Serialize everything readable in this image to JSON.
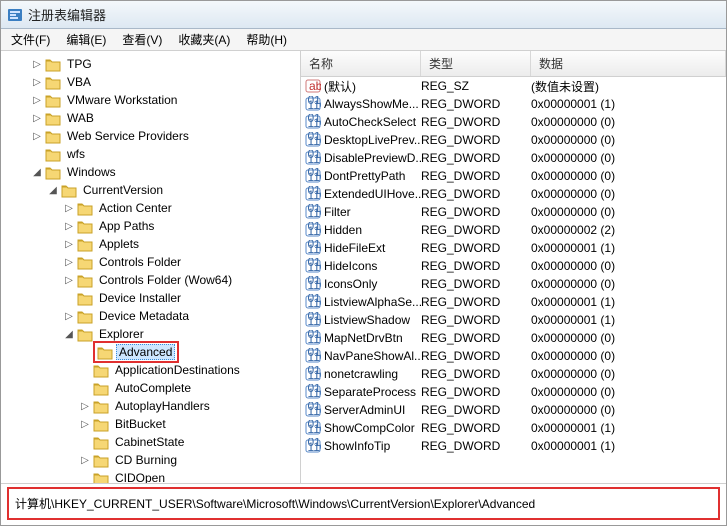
{
  "window": {
    "title": "注册表编辑器"
  },
  "menu": {
    "file": "文件(F)",
    "edit": "编辑(E)",
    "view": "查看(V)",
    "favorites": "收藏夹(A)",
    "help": "帮助(H)"
  },
  "tree": {
    "nodes": [
      {
        "label": "TPG",
        "caret": "closed"
      },
      {
        "label": "VBA",
        "caret": "closed"
      },
      {
        "label": "VMware Workstation",
        "caret": "closed"
      },
      {
        "label": "WAB",
        "caret": "closed"
      },
      {
        "label": "Web Service Providers",
        "caret": "closed"
      },
      {
        "label": "wfs",
        "caret": "none"
      },
      {
        "label": "Windows",
        "caret": "open",
        "children": [
          {
            "label": "CurrentVersion",
            "caret": "open",
            "children": [
              {
                "label": "Action Center",
                "caret": "closed"
              },
              {
                "label": "App Paths",
                "caret": "closed"
              },
              {
                "label": "Applets",
                "caret": "closed"
              },
              {
                "label": "Controls Folder",
                "caret": "closed"
              },
              {
                "label": "Controls Folder (Wow64)",
                "caret": "closed"
              },
              {
                "label": "Device Installer",
                "caret": "none"
              },
              {
                "label": "Device Metadata",
                "caret": "closed"
              },
              {
                "label": "Explorer",
                "caret": "open",
                "children": [
                  {
                    "label": "Advanced",
                    "caret": "none",
                    "selected": true,
                    "highlighted": true
                  },
                  {
                    "label": "ApplicationDestinations",
                    "caret": "none"
                  },
                  {
                    "label": "AutoComplete",
                    "caret": "none"
                  },
                  {
                    "label": "AutoplayHandlers",
                    "caret": "closed"
                  },
                  {
                    "label": "BitBucket",
                    "caret": "closed"
                  },
                  {
                    "label": "CabinetState",
                    "caret": "none"
                  },
                  {
                    "label": "CD Burning",
                    "caret": "closed"
                  },
                  {
                    "label": "CIDOpen",
                    "caret": "none"
                  }
                ]
              }
            ]
          }
        ]
      }
    ]
  },
  "list": {
    "cols": {
      "name": "名称",
      "type": "类型",
      "data": "数据"
    },
    "rows": [
      {
        "name": "(默认)",
        "type": "REG_SZ",
        "data": "(数值未设置)",
        "icon": "string"
      },
      {
        "name": "AlwaysShowMe...",
        "type": "REG_DWORD",
        "data": "0x00000001 (1)",
        "icon": "binary"
      },
      {
        "name": "AutoCheckSelect",
        "type": "REG_DWORD",
        "data": "0x00000000 (0)",
        "icon": "binary"
      },
      {
        "name": "DesktopLivePrev...",
        "type": "REG_DWORD",
        "data": "0x00000000 (0)",
        "icon": "binary"
      },
      {
        "name": "DisablePreviewD...",
        "type": "REG_DWORD",
        "data": "0x00000000 (0)",
        "icon": "binary"
      },
      {
        "name": "DontPrettyPath",
        "type": "REG_DWORD",
        "data": "0x00000000 (0)",
        "icon": "binary"
      },
      {
        "name": "ExtendedUIHove...",
        "type": "REG_DWORD",
        "data": "0x00000000 (0)",
        "icon": "binary"
      },
      {
        "name": "Filter",
        "type": "REG_DWORD",
        "data": "0x00000000 (0)",
        "icon": "binary"
      },
      {
        "name": "Hidden",
        "type": "REG_DWORD",
        "data": "0x00000002 (2)",
        "icon": "binary"
      },
      {
        "name": "HideFileExt",
        "type": "REG_DWORD",
        "data": "0x00000001 (1)",
        "icon": "binary"
      },
      {
        "name": "HideIcons",
        "type": "REG_DWORD",
        "data": "0x00000000 (0)",
        "icon": "binary"
      },
      {
        "name": "IconsOnly",
        "type": "REG_DWORD",
        "data": "0x00000000 (0)",
        "icon": "binary"
      },
      {
        "name": "ListviewAlphaSe...",
        "type": "REG_DWORD",
        "data": "0x00000001 (1)",
        "icon": "binary"
      },
      {
        "name": "ListviewShadow",
        "type": "REG_DWORD",
        "data": "0x00000001 (1)",
        "icon": "binary"
      },
      {
        "name": "MapNetDrvBtn",
        "type": "REG_DWORD",
        "data": "0x00000000 (0)",
        "icon": "binary"
      },
      {
        "name": "NavPaneShowAl...",
        "type": "REG_DWORD",
        "data": "0x00000000 (0)",
        "icon": "binary"
      },
      {
        "name": "nonetcrawling",
        "type": "REG_DWORD",
        "data": "0x00000000 (0)",
        "icon": "binary"
      },
      {
        "name": "SeparateProcess",
        "type": "REG_DWORD",
        "data": "0x00000000 (0)",
        "icon": "binary"
      },
      {
        "name": "ServerAdminUI",
        "type": "REG_DWORD",
        "data": "0x00000000 (0)",
        "icon": "binary"
      },
      {
        "name": "ShowCompColor",
        "type": "REG_DWORD",
        "data": "0x00000001 (1)",
        "icon": "binary"
      },
      {
        "name": "ShowInfoTip",
        "type": "REG_DWORD",
        "data": "0x00000001 (1)",
        "icon": "binary"
      }
    ]
  },
  "status": {
    "path": "计算机\\HKEY_CURRENT_USER\\Software\\Microsoft\\Windows\\CurrentVersion\\Explorer\\Advanced"
  }
}
